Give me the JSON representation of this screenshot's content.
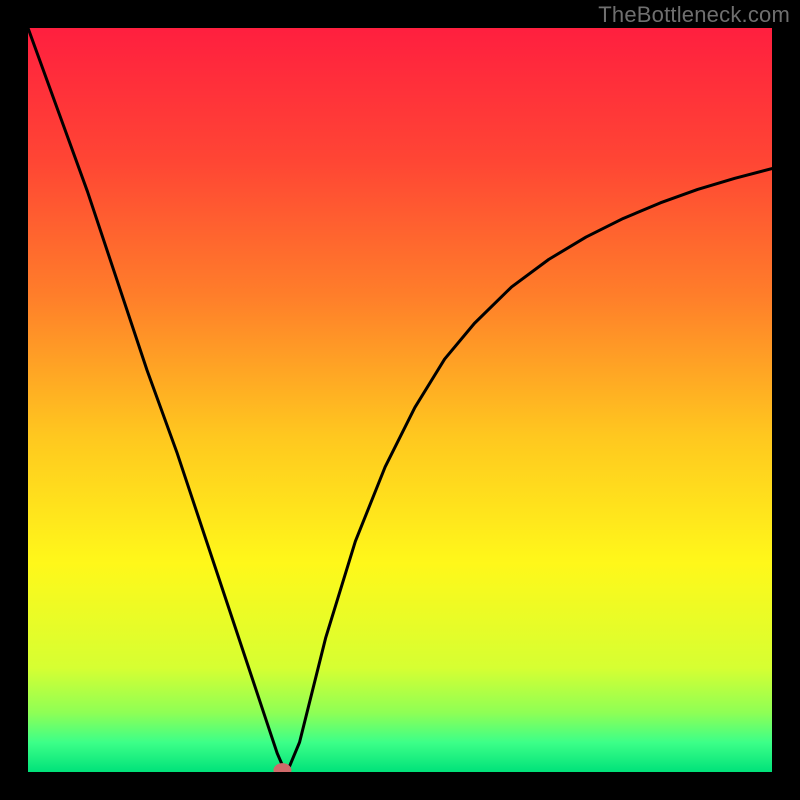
{
  "watermark": {
    "text": "TheBottleneck.com"
  },
  "chart_data": {
    "type": "line",
    "title": "",
    "xlabel": "",
    "ylabel": "",
    "xlim": [
      0,
      100
    ],
    "ylim": [
      0,
      100
    ],
    "series": [
      {
        "name": "bottleneck-curve",
        "x": [
          0,
          4,
          8,
          12,
          16,
          20,
          24,
          28,
          30,
          32,
          33.5,
          34.5,
          35,
          36.5,
          38,
          40,
          44,
          48,
          52,
          56,
          60,
          65,
          70,
          75,
          80,
          85,
          90,
          95,
          100
        ],
        "y": [
          100,
          89,
          78,
          66,
          54,
          43,
          31,
          19,
          13,
          7,
          2.5,
          0.2,
          0.4,
          4,
          10,
          18,
          31,
          41,
          49,
          55.5,
          60.3,
          65.2,
          68.9,
          71.9,
          74.4,
          76.5,
          78.3,
          79.8,
          81.1
        ]
      }
    ],
    "marker": {
      "x": 34.2,
      "y": 0.25
    },
    "gradient_stops": [
      {
        "offset": 0.0,
        "color": "#ff1f3f"
      },
      {
        "offset": 0.18,
        "color": "#ff4634"
      },
      {
        "offset": 0.36,
        "color": "#ff7e2a"
      },
      {
        "offset": 0.55,
        "color": "#ffc81f"
      },
      {
        "offset": 0.72,
        "color": "#fff81a"
      },
      {
        "offset": 0.86,
        "color": "#d6ff32"
      },
      {
        "offset": 0.92,
        "color": "#8fff55"
      },
      {
        "offset": 0.96,
        "color": "#3dff88"
      },
      {
        "offset": 1.0,
        "color": "#00e27a"
      }
    ]
  }
}
